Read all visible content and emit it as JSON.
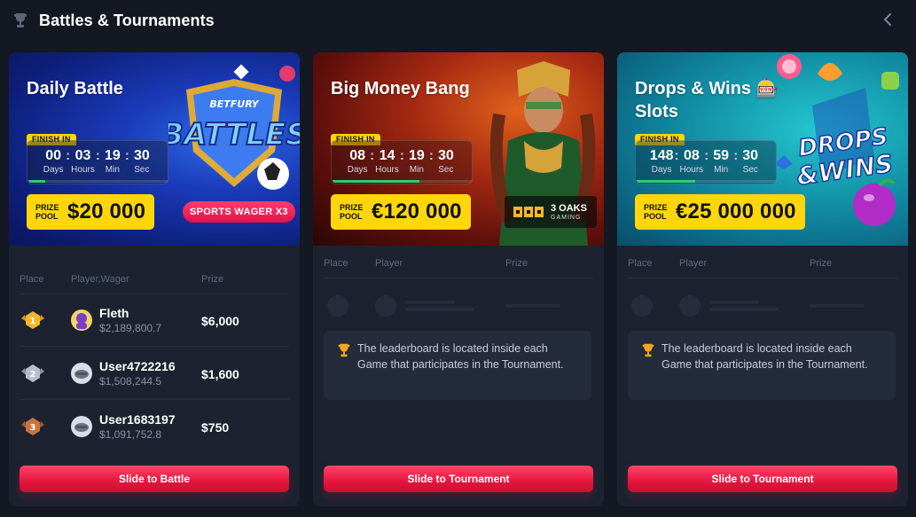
{
  "header": {
    "title": "Battles & Tournaments",
    "trophy_icon": "trophy-icon",
    "back_icon": "chevron-left-icon"
  },
  "timer_labels": {
    "days": "Days",
    "hours": "Hours",
    "min": "Min",
    "sec": "Sec"
  },
  "cards": [
    {
      "title": "Daily Battle",
      "finish_label": "FINISH IN",
      "timer": {
        "days": "00",
        "hours": "03",
        "min": "19",
        "sec": "30"
      },
      "progress": 0.12,
      "prize_label": "PRIZE POOL",
      "prize_value": "$20 000",
      "badge": "SPORTS WAGER X3",
      "art_text": "BETFURY BATTLES",
      "columns": {
        "place": "Place",
        "player": "Player,Wager",
        "prize": "Prize"
      },
      "rows": [
        {
          "place": "1",
          "name": "Fleth",
          "wager": "$2,189,800.7",
          "prize": "$6,000"
        },
        {
          "place": "2",
          "name": "User4722216",
          "wager": "$1,508,244.5",
          "prize": "$1,600"
        },
        {
          "place": "3",
          "name": "User1683197",
          "wager": "$1,091,752.8",
          "prize": "$750"
        }
      ],
      "button": "Slide to Battle"
    },
    {
      "title": "Big Money Bang",
      "finish_label": "FINISH IN",
      "timer": {
        "days": "08",
        "hours": "14",
        "min": "19",
        "sec": "30"
      },
      "progress": 0.62,
      "prize_label": "PRIZE POOL",
      "prize_value": "€120 000",
      "provider": "3 OAKS",
      "provider_sub": "GAMING",
      "columns": {
        "place": "Place",
        "player": "Player",
        "prize": "Prize"
      },
      "notice": "The leaderboard is located inside each Game that participates in the Tournament.",
      "button": "Slide to Tournament"
    },
    {
      "title": "Drops & Wins 🎰 Slots",
      "finish_label": "FINISH IN",
      "timer": {
        "days": "148",
        "hours": "08",
        "min": "59",
        "sec": "30"
      },
      "progress": 0.42,
      "prize_label": "PRIZE POOL",
      "prize_value": "€25 000 000",
      "art_text": "DROPS &WINS",
      "columns": {
        "place": "Place",
        "player": "Player",
        "prize": "Prize"
      },
      "notice": "The leaderboard is located inside each Game that participates in the Tournament.",
      "button": "Slide to Tournament"
    }
  ],
  "colors": {
    "background": "#141823",
    "card": "#1c2230",
    "accent_yellow": "#ffd60a",
    "button_red": "#e5163f",
    "progress_green": "#2ecc71"
  }
}
